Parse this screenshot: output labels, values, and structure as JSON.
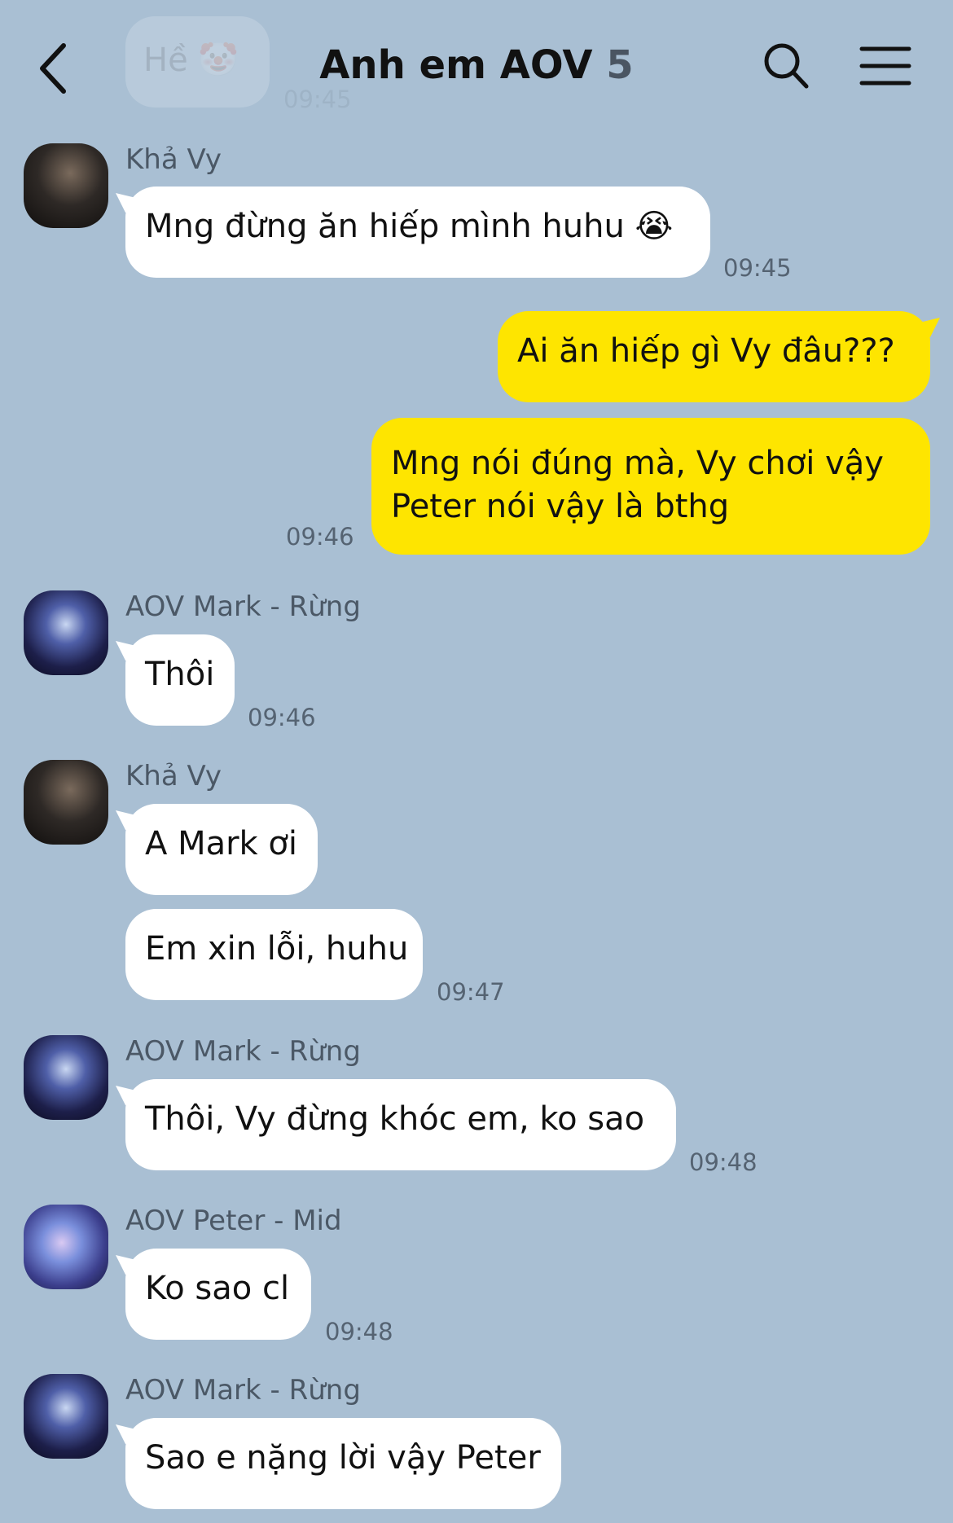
{
  "header": {
    "title": "Anh em AOV",
    "member_count": "5",
    "back_icon": "back-chevron-icon",
    "search_icon": "search-icon",
    "menu_icon": "hamburger-menu-icon"
  },
  "faded_top": {
    "text": "Hề 🤡",
    "time": "09:45"
  },
  "messages": [
    {
      "sender": "Khả Vy",
      "text": "Mng đừng ăn hiếp mình huhu 😭",
      "time": "09:45"
    },
    {
      "text": "Ai ăn hiếp gì Vy đâu???"
    },
    {
      "line1": "Mng nói đúng mà, Vy chơi vậy",
      "line2": "Peter nói vậy là bthg",
      "time": "09:46"
    },
    {
      "sender": "AOV Mark - Rừng",
      "text": "Thôi",
      "time": "09:46"
    },
    {
      "sender": "Khả Vy",
      "text": "A Mark ơi"
    },
    {
      "text": "Em xin lỗi, huhu",
      "time": "09:47"
    },
    {
      "sender": "AOV Mark - Rừng",
      "text": "Thôi, Vy đừng khóc em, ko sao",
      "time": "09:48"
    },
    {
      "sender": "AOV Peter - Mid",
      "text": "Ko sao cl",
      "time": "09:48"
    },
    {
      "sender": "AOV Mark - Rừng",
      "text": "Sao e nặng lời vậy Peter"
    }
  ],
  "colors": {
    "background": "#a9bfd3",
    "my_bubble": "#fee500",
    "other_bubble": "#ffffff"
  }
}
